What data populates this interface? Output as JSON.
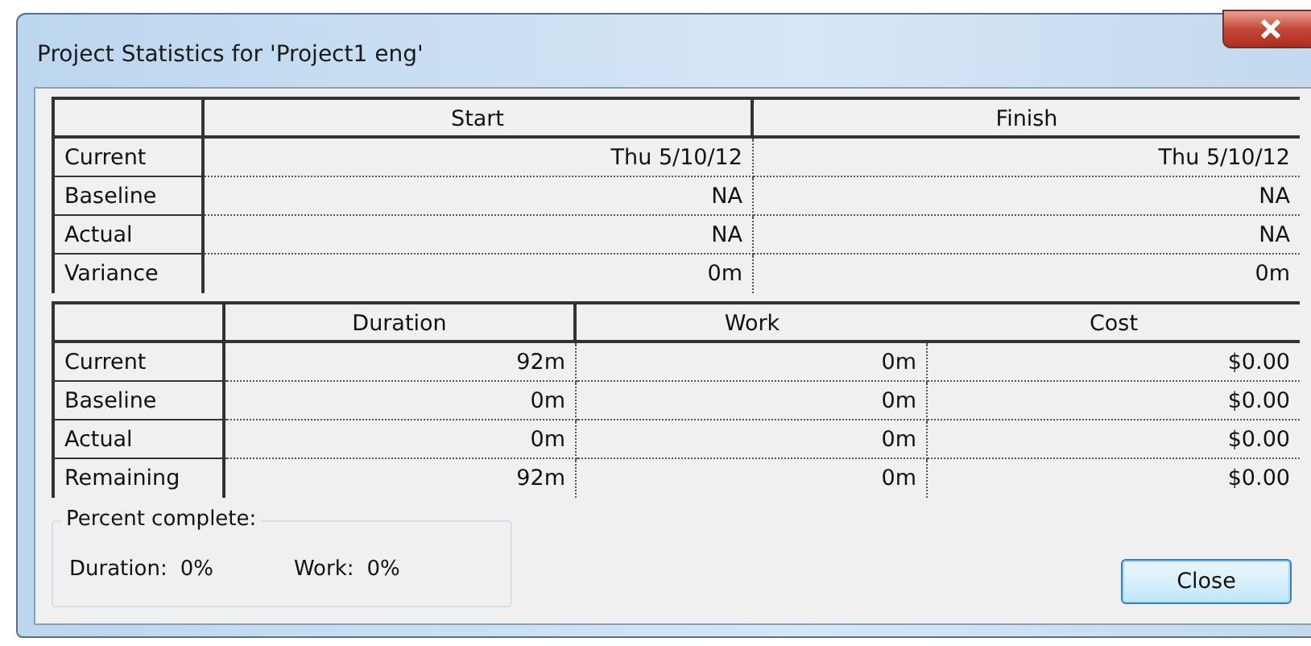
{
  "window": {
    "title": "Project Statistics for 'Project1 eng'"
  },
  "dates_table": {
    "columns": [
      "Start",
      "Finish"
    ],
    "rows": [
      {
        "label": "Current",
        "values": [
          "Thu 5/10/12",
          "Thu 5/10/12"
        ]
      },
      {
        "label": "Baseline",
        "values": [
          "NA",
          "NA"
        ]
      },
      {
        "label": "Actual",
        "values": [
          "NA",
          "NA"
        ]
      },
      {
        "label": "Variance",
        "values": [
          "0m",
          "0m"
        ]
      }
    ]
  },
  "totals_table": {
    "columns": [
      "Duration",
      "Work",
      "Cost"
    ],
    "rows": [
      {
        "label": "Current",
        "values": [
          "92m",
          "0m",
          "$0.00"
        ]
      },
      {
        "label": "Baseline",
        "values": [
          "0m",
          "0m",
          "$0.00"
        ]
      },
      {
        "label": "Actual",
        "values": [
          "0m",
          "0m",
          "$0.00"
        ]
      },
      {
        "label": "Remaining",
        "values": [
          "92m",
          "0m",
          "$0.00"
        ]
      }
    ]
  },
  "percent_complete": {
    "title": "Percent complete:",
    "items": [
      {
        "label": "Duration:",
        "value": "0%"
      },
      {
        "label": "Work:",
        "value": "0%"
      }
    ]
  },
  "buttons": [
    "Close"
  ]
}
